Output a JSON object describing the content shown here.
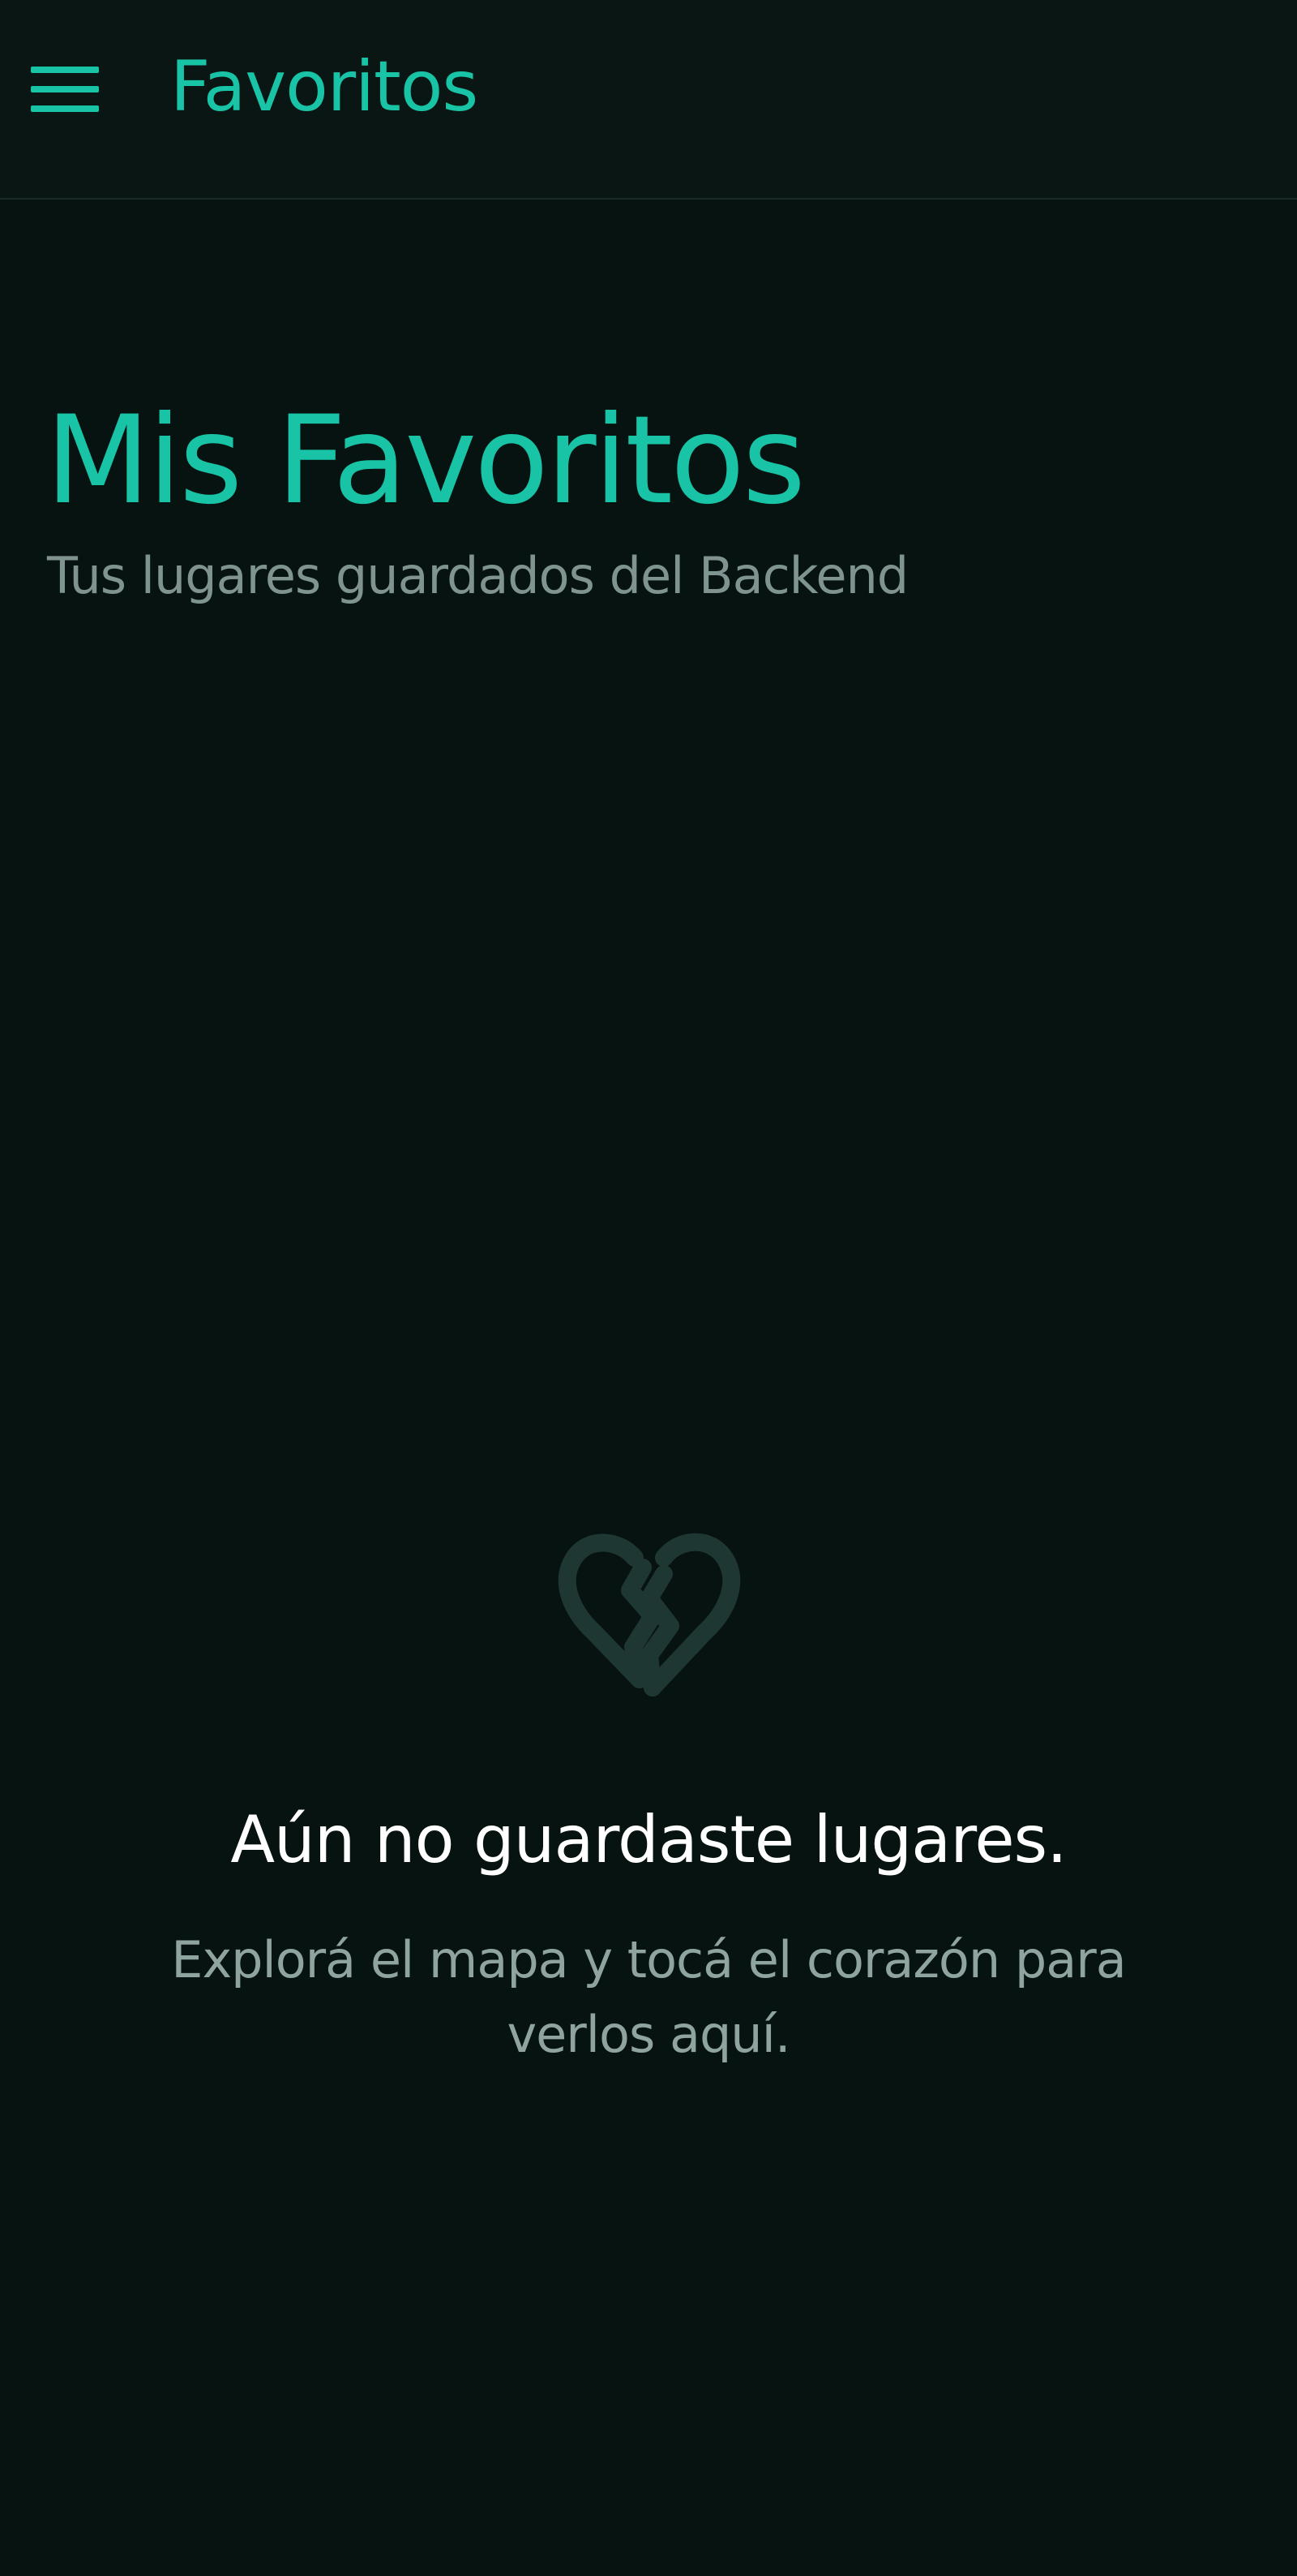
{
  "header": {
    "menu_icon": "hamburger-menu-icon",
    "title": "Favoritos"
  },
  "main": {
    "title": "Mis Favoritos",
    "subtitle": "Tus lugares guardados del Backend"
  },
  "empty_state": {
    "icon": "broken-heart-icon",
    "title": "Aún no guardaste lugares.",
    "message": "Explorá el mapa y tocá el corazón para verlos aquí."
  },
  "colors": {
    "background": "#071311",
    "accent": "#19c4a6",
    "muted_text": "#8fa4a0",
    "icon_muted": "#1f3733"
  }
}
